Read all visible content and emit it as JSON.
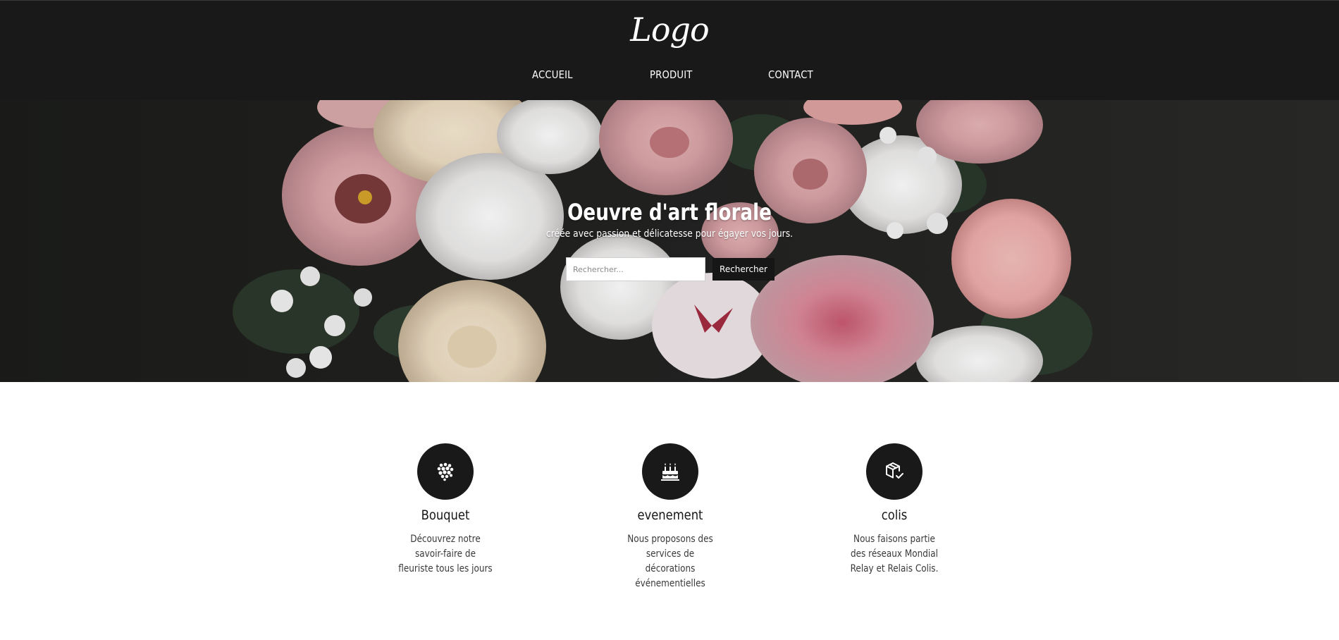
{
  "header": {
    "logo": "Logo",
    "nav": [
      "ACCUEIL",
      "PRODUIT",
      "CONTACT"
    ]
  },
  "hero": {
    "title": "Oeuvre d'art florale",
    "subtitle": "créée avec passion et délicatesse pour égayer vos jours.",
    "search_placeholder": "Rechercher...",
    "search_button": "Rechercher"
  },
  "features": [
    {
      "icon": "bouquet-icon",
      "title": "Bouquet",
      "description": "Découvrez notre savoir-faire de fleuriste tous les jours"
    },
    {
      "icon": "cake-icon",
      "title": "evenement",
      "description": "Nous proposons des services de décorations événementielles"
    },
    {
      "icon": "package-check-icon",
      "title": "colis",
      "description": "Nous faisons partie des réseaux Mondial Relay et Relais Colis."
    }
  ],
  "colors": {
    "header_bg": "#191919",
    "hero_bg": "#1d1d1c",
    "accent": "#161616",
    "text": "#3a3a3a"
  }
}
